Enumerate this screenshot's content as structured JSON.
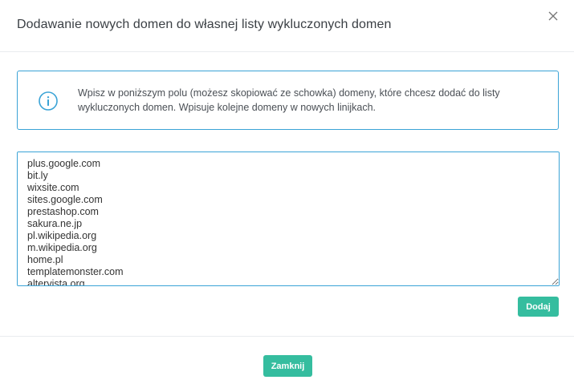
{
  "modal": {
    "title": "Dodawanie nowych domen do własnej listy wykluczonych domen",
    "close_icon": "close-icon"
  },
  "info": {
    "icon": "info-circle-icon",
    "text": "Wpisz w poniższym polu (możesz skopiować ze schowka) domeny, które chcesz dodać do listy wykluczonych domen. Wpisuje kolejne domeny w nowych linijkach."
  },
  "domains": {
    "value": "plus.google.com\nbit.ly\nwixsite.com\nsites.google.com\nprestashop.com\nsakura.ne.jp\npl.wikipedia.org\nm.wikipedia.org\nhome.pl\ntemplatemonster.com\naltervista.org"
  },
  "buttons": {
    "add_label": "Dodaj",
    "close_label": "Zamknij"
  },
  "colors": {
    "accent_border": "#3aa3d6",
    "button_green": "#35bd9f"
  }
}
